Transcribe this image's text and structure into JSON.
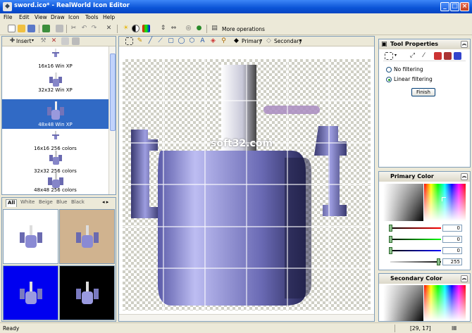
{
  "window": {
    "title": "sword.ico* - RealWorld Icon Editor"
  },
  "menu": [
    "File",
    "Edit",
    "View",
    "Draw",
    "Icon",
    "Tools",
    "Help"
  ],
  "toolbar": {
    "more_operations": "More operations"
  },
  "left": {
    "insert_label": "Insert"
  },
  "formats": [
    {
      "label": "16x16 Win XP"
    },
    {
      "label": "32x32 Win XP"
    },
    {
      "label": "48x48 Win XP",
      "selected": true
    },
    {
      "label": "16x16 256 colors"
    },
    {
      "label": "32x32 256 colors"
    },
    {
      "label": "48x48 256 colors"
    }
  ],
  "preview": {
    "tabs": [
      "All",
      "White",
      "Beige",
      "Blue",
      "Black"
    ],
    "backgrounds": [
      "#ffffff",
      "#d0b38f",
      "#0000f0",
      "#000000"
    ]
  },
  "canvas_toolbar": {
    "primary_label": "Primary",
    "secondary_label": "Secondary"
  },
  "canvas": {
    "watermark": "soft32.com"
  },
  "tool_properties": {
    "title": "Tool Properties",
    "no_filtering": "No filtering",
    "linear_filtering": "Linear filtering",
    "finish_label": "Finish"
  },
  "primary_color": {
    "title": "Primary Color",
    "r": "0",
    "g": "0",
    "b": "0",
    "a": "255"
  },
  "secondary_color": {
    "title": "Secondary Color"
  },
  "status": {
    "text": "Ready",
    "coords": "[29, 17]"
  },
  "colors": {
    "accent": "#316ac5",
    "title_blue": "#0a53d6"
  }
}
